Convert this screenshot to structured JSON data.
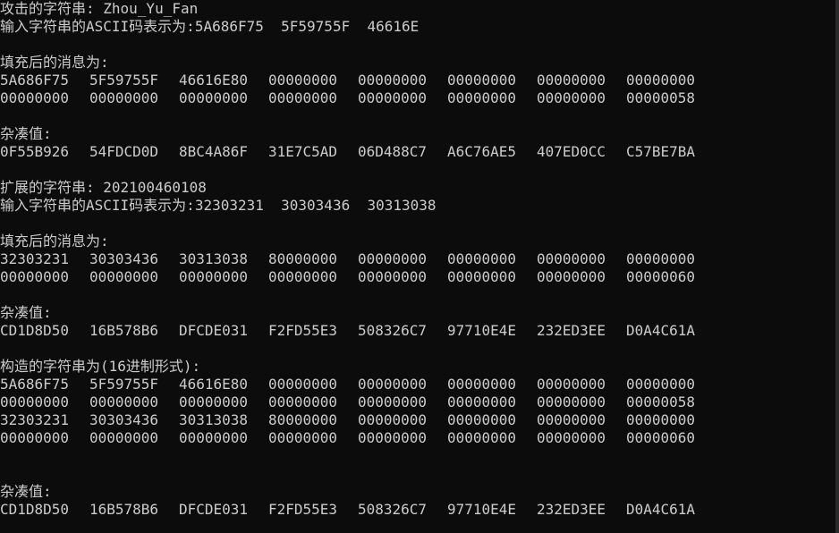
{
  "block1": {
    "attack_label": "攻击的字符串: Zhou_Yu_Fan",
    "ascii_label": "输入字符串的ASCII码表示为:",
    "ascii_values": [
      "5A686F75",
      "5F59755F",
      "46616E"
    ],
    "padded_label": "填充后的消息为:",
    "padded_rows": [
      [
        "5A686F75",
        "5F59755F",
        "46616E80",
        "00000000",
        "00000000",
        "00000000",
        "00000000",
        "00000000"
      ],
      [
        "00000000",
        "00000000",
        "00000000",
        "00000000",
        "00000000",
        "00000000",
        "00000000",
        "00000058"
      ]
    ],
    "hash_label": "杂凑值:",
    "hash_row": [
      "0F55B926",
      "54FDCD0D",
      "8BC4A86F",
      "31E7C5AD",
      "06D488C7",
      "A6C76AE5",
      "407ED0CC",
      "C57BE7BA"
    ]
  },
  "block2": {
    "ext_label": "扩展的字符串: 202100460108",
    "ascii_label": "输入字符串的ASCII码表示为:",
    "ascii_values": [
      "32303231",
      "30303436",
      "30313038"
    ],
    "padded_label": "填充后的消息为:",
    "padded_rows": [
      [
        "32303231",
        "30303436",
        "30313038",
        "80000000",
        "00000000",
        "00000000",
        "00000000",
        "00000000"
      ],
      [
        "00000000",
        "00000000",
        "00000000",
        "00000000",
        "00000000",
        "00000000",
        "00000000",
        "00000060"
      ]
    ],
    "hash_label": "杂凑值:",
    "hash_row": [
      "CD1D8D50",
      "16B578B6",
      "DFCDE031",
      "F2FD55E3",
      "508326C7",
      "97710E4E",
      "232ED3EE",
      "D0A4C61A"
    ]
  },
  "block3": {
    "construct_label": "构造的字符串为(16进制形式):",
    "rows": [
      [
        "5A686F75",
        "5F59755F",
        "46616E80",
        "00000000",
        "00000000",
        "00000000",
        "00000000",
        "00000000"
      ],
      [
        "00000000",
        "00000000",
        "00000000",
        "00000000",
        "00000000",
        "00000000",
        "00000000",
        "00000058"
      ],
      [
        "32303231",
        "30303436",
        "30313038",
        "80000000",
        "00000000",
        "00000000",
        "00000000",
        "00000000"
      ],
      [
        "00000000",
        "00000000",
        "00000000",
        "00000000",
        "00000000",
        "00000000",
        "00000000",
        "00000060"
      ]
    ],
    "hash_label": "杂凑值:",
    "hash_row": [
      "CD1D8D50",
      "16B578B6",
      "DFCDE031",
      "F2FD55E3",
      "508326C7",
      "97710E4E",
      "232ED3EE",
      "D0A4C61A"
    ]
  },
  "colors": {
    "background": "#0c0c0c",
    "text": "#cccccc"
  }
}
